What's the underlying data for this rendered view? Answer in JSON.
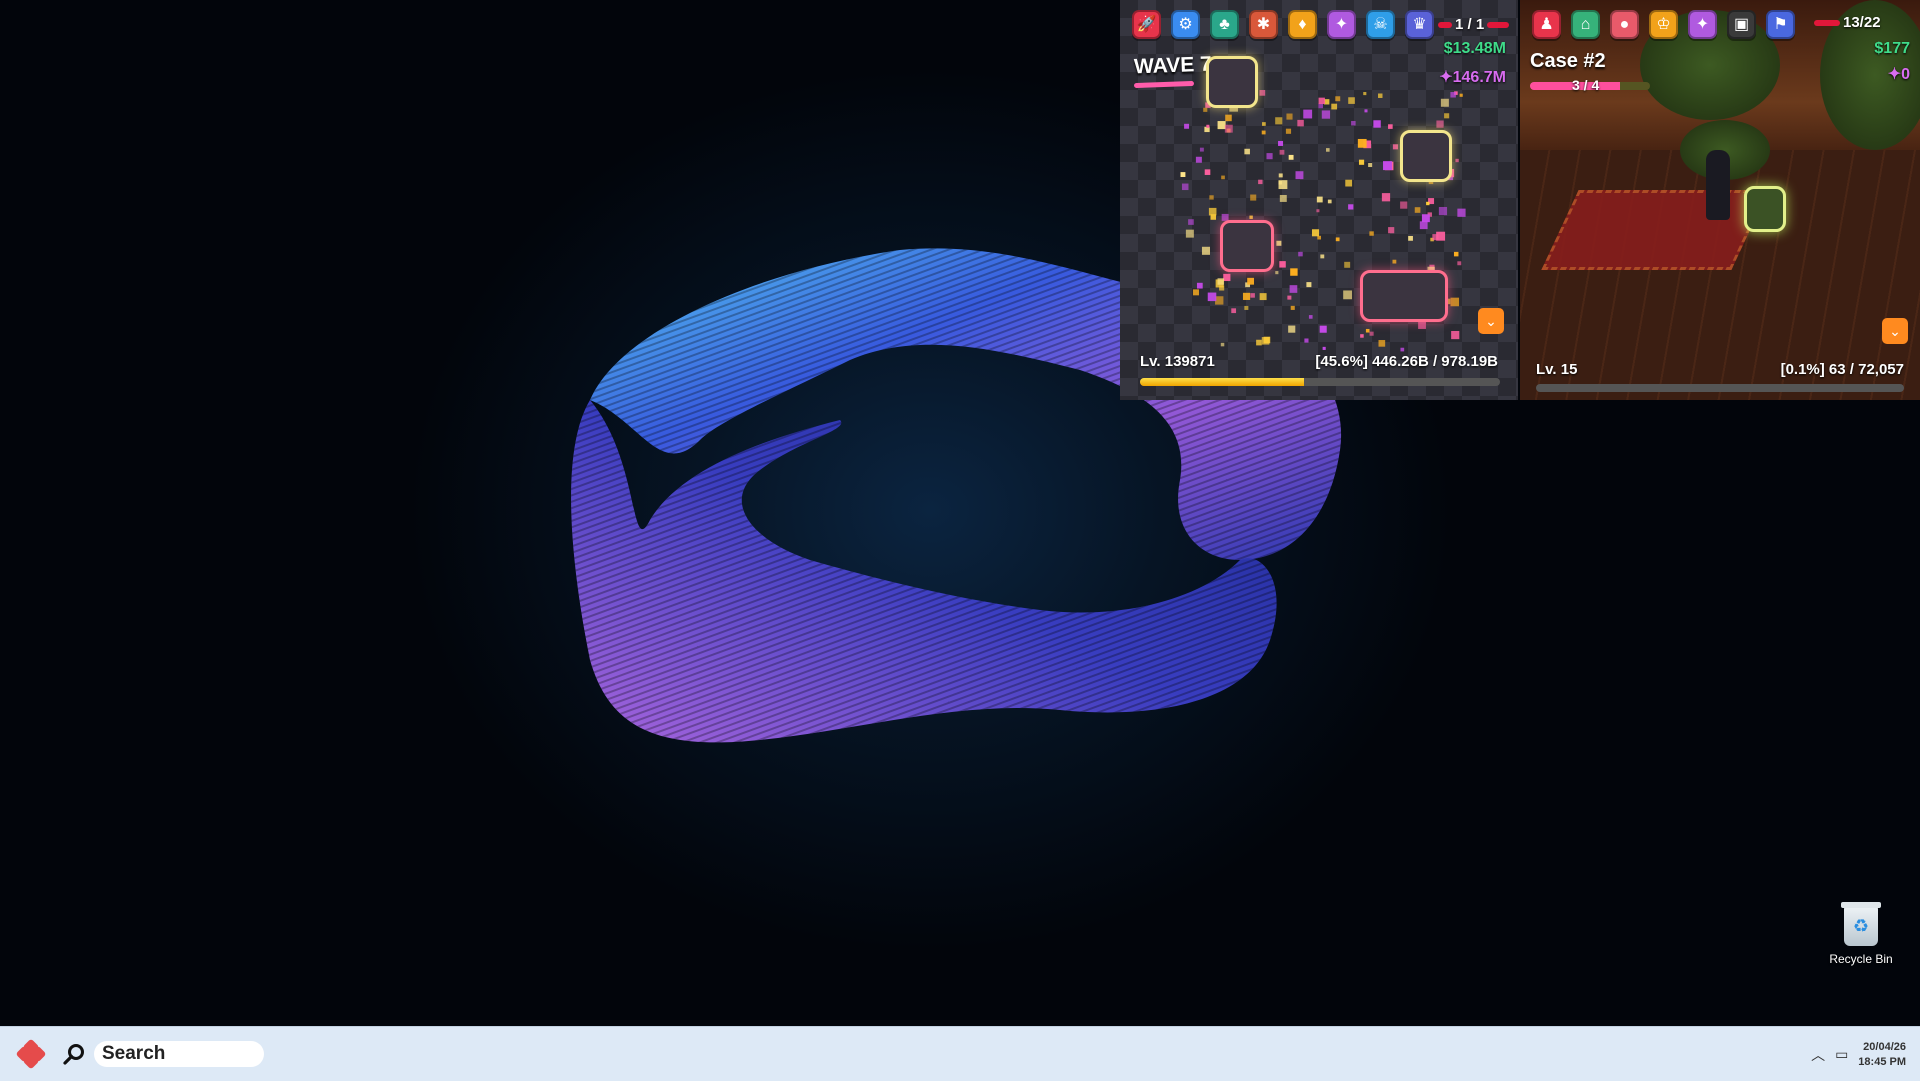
{
  "desktop": {
    "recycle_bin_label": "Recycle Bin"
  },
  "game_tower": {
    "toolbar_icons": [
      "rocket-icon",
      "gear-icon",
      "tree-icon",
      "bug-icon",
      "lightbulb-icon",
      "sparkle-icon",
      "skull-icon",
      "trophy-icon"
    ],
    "toolbar_colors": [
      "#e8344b",
      "#3a8cf0",
      "#2aa78a",
      "#d9583a",
      "#f2a21a",
      "#b05ae0",
      "#2f9ee8",
      "#5a62d8"
    ],
    "lives": "1 / 1",
    "cash": "$13.48M",
    "gems": "146.7M",
    "wave": "WAVE 7",
    "level": "Lv. 139871",
    "xp_text": "[45.6%] 446.26B / 978.19B",
    "xp_percent": 45.6
  },
  "game_mystery": {
    "toolbar_icons": [
      "person-icon",
      "house-icon",
      "bag-icon",
      "crown-icon",
      "sparkle-icon",
      "lock-icon",
      "flag-icon"
    ],
    "toolbar_colors": [
      "#e8344b",
      "#36b27a",
      "#e85a6a",
      "#f2a21a",
      "#b05ae0",
      "#3a3a3a",
      "#4a68e0"
    ],
    "lives": "13/22",
    "cash": "$177",
    "gems": "0",
    "case_title": "Case #2",
    "case_progress": "3 / 4",
    "case_progress_fraction": 0.75,
    "level": "Lv. 15",
    "xp_text": "[0.1%] 63 / 72,057",
    "xp_percent": 0.1
  },
  "taskbar": {
    "search_label": "Search",
    "date": "20/04/26",
    "time": "18:45 PM"
  }
}
